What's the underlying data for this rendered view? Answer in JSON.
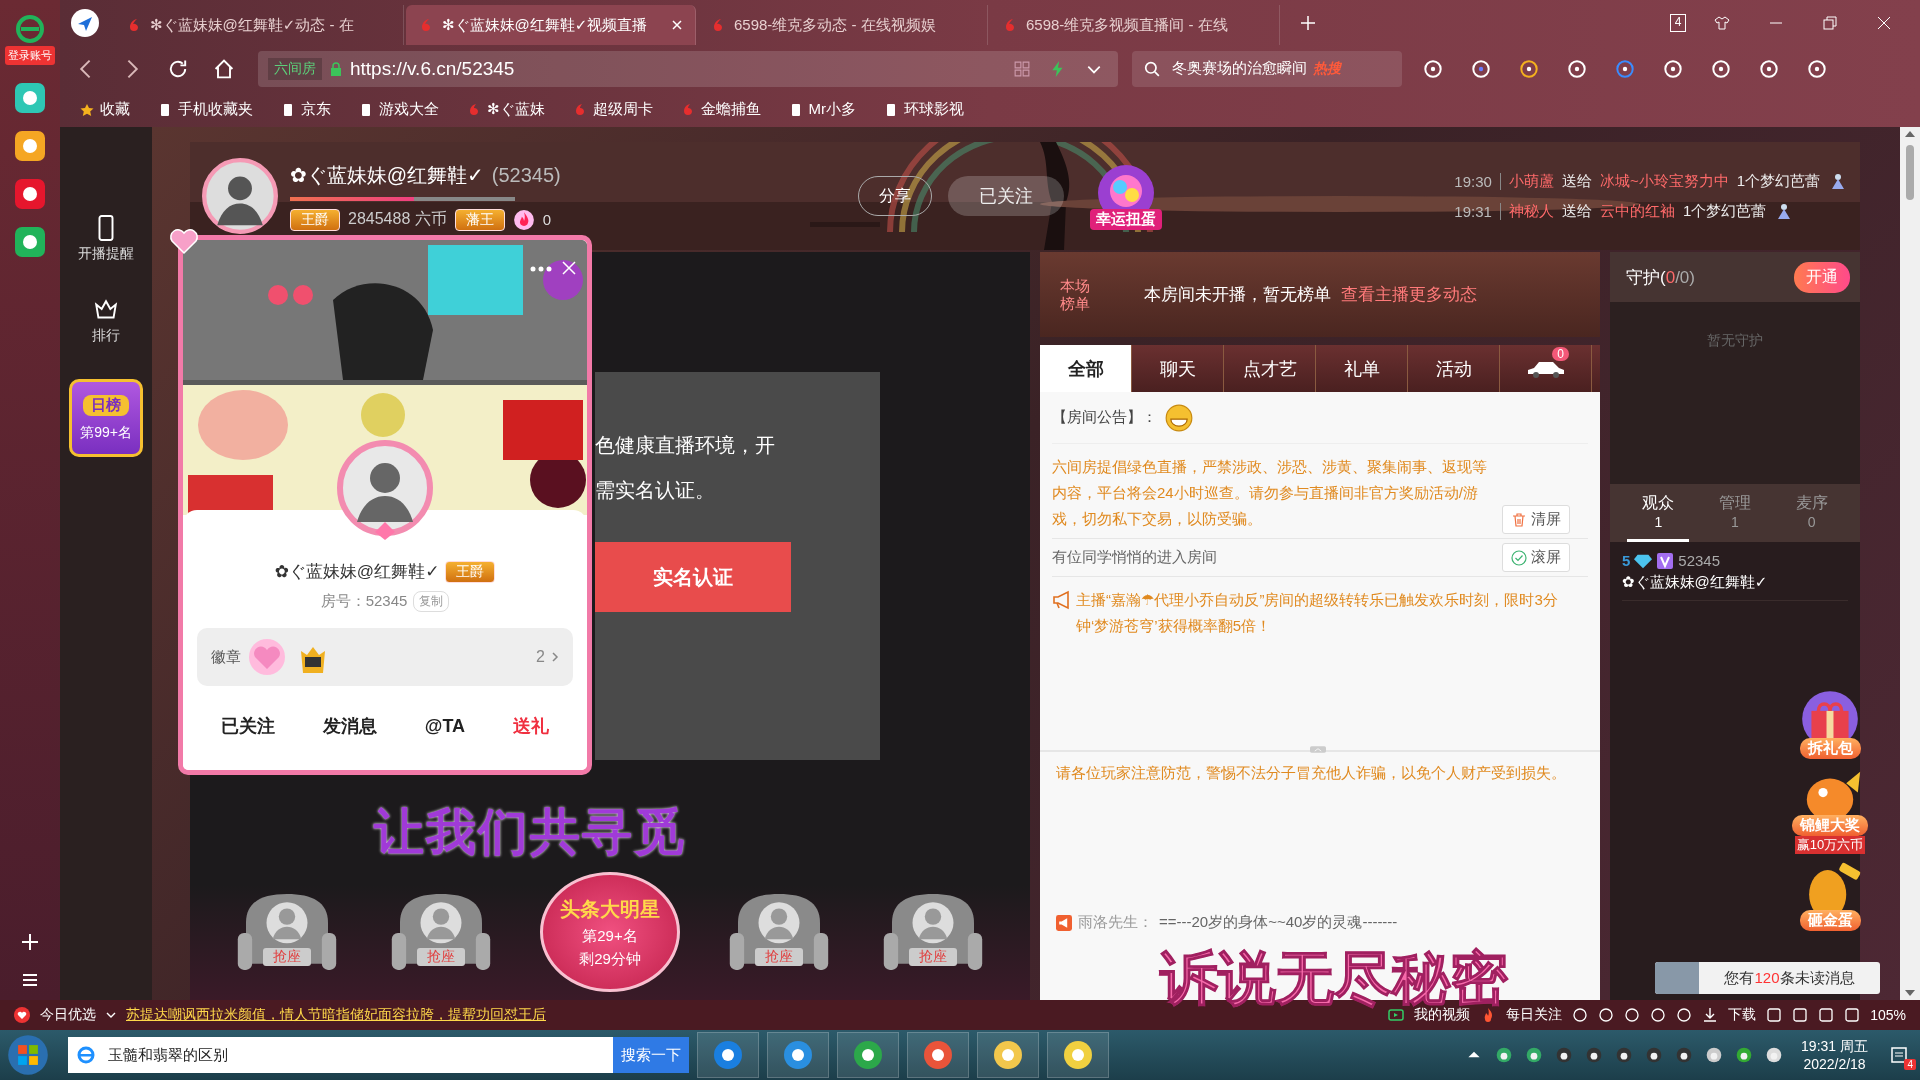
{
  "browser_sidebar": {
    "login": "登录账号"
  },
  "tabs": [
    {
      "title": "✻ぐ蓝妹妹@红舞鞋✓动态 - 在",
      "selected": false
    },
    {
      "title": "✻ぐ蓝妹妹@红舞鞋✓视频直播",
      "selected": true
    },
    {
      "title": "6598-维克多动态 - 在线视频娱",
      "selected": false
    },
    {
      "title": "6598-维克多视频直播间 - 在线",
      "selected": false
    }
  ],
  "tab_count": "4",
  "address_bar": {
    "site_label": "六间房",
    "url": "https://v.6.cn/52345"
  },
  "search": {
    "value": "冬奥赛场的治愈瞬间",
    "tag": "热搜"
  },
  "bookmarks": [
    "收藏",
    "手机收藏夹",
    "京东",
    "游戏大全",
    "✻ぐ蓝妹",
    "超级周卡",
    "金蟾捕鱼",
    "Mr小多",
    "环球影视"
  ],
  "site_sidebar": {
    "items": [
      "开播提醒",
      "排行"
    ],
    "daily_rank": {
      "title": "日榜",
      "rank": "第99+名"
    }
  },
  "anchor": {
    "name": "✿ぐ蓝妹妹@红舞鞋✓",
    "room_id": "(52345)",
    "level": 0.55,
    "title_badge": "王爵",
    "coins": "2845488 六币",
    "rank_badge": "藩王",
    "heat": "0",
    "share": "分享",
    "follow": "已关注",
    "lucky_egg": "幸运扭蛋"
  },
  "gift_feed": [
    {
      "time": "19:30",
      "sender": "小萌蘆",
      "verb": "送给",
      "receiver": "冰城~小玲宝努力中",
      "gift": "1个梦幻芭蕾"
    },
    {
      "time": "19:31",
      "sender": "神秘人",
      "verb": "送给",
      "receiver": "云中的红袖",
      "gift": "1个梦幻芭蕾"
    }
  ],
  "video": {
    "notice_lines": [
      "色健康直播环境，开",
      "需实名认证。"
    ],
    "verify_button": "实名认证",
    "banner_text": "让我们共寻觅",
    "overlay_text": "诉说无尽秘密",
    "seats": [
      {
        "kind": "seat",
        "label": "抢座"
      },
      {
        "kind": "seat",
        "label": "抢座"
      },
      {
        "kind": "star",
        "title": "头条大明星",
        "rank": "第29+名",
        "timer": "剩29分钟"
      },
      {
        "kind": "seat",
        "label": "抢座"
      },
      {
        "kind": "seat",
        "label": "抢座"
      }
    ]
  },
  "profile_card": {
    "name": "✿ぐ蓝妹妹@红舞鞋✓",
    "title_badge": "王爵",
    "room_label": "房号：52345",
    "copy": "复制",
    "badges_label": "徽章",
    "badge_count": "2",
    "actions": [
      {
        "label": "已关注",
        "highlight": false
      },
      {
        "label": "发消息",
        "highlight": false
      },
      {
        "label": "@TA",
        "highlight": false
      },
      {
        "label": "送礼",
        "highlight": true
      }
    ]
  },
  "chat": {
    "rank_label": [
      "本场",
      "榜单"
    ],
    "rank_empty": "本房间未开播，暂无榜单",
    "rank_link": "查看主播更多动态",
    "tabs": [
      {
        "kind": "text",
        "label": "全部",
        "selected": true
      },
      {
        "kind": "text",
        "label": "聊天",
        "selected": false
      },
      {
        "kind": "text",
        "label": "点才艺",
        "selected": false
      },
      {
        "kind": "text",
        "label": "礼单",
        "selected": false
      },
      {
        "kind": "text",
        "label": "活动",
        "selected": false
      },
      {
        "kind": "car",
        "badge": "0",
        "selected": false
      }
    ],
    "announcement_label": "【房间公告】：",
    "notice": "六间房提倡绿色直播，严禁涉政、涉恐、涉黄、聚集闹事、返现等内容，平台将会24小时巡查。请勿参与直播间非官方奖励活动/游戏，切勿私下交易，以防受骗。",
    "clear": "清屏",
    "scroll": "滚屏",
    "entry": "有位同学悄悄的进入房间",
    "broadcast": "主播“嘉瀚☂代理小乔自动反”房间的超级转转乐已触发欢乐时刻，限时3分钟‘梦游苍穹’获得概率翻5倍！",
    "warning": "请各位玩家注意防范，警惕不法分子冒充他人诈骗，以免个人财产受到损失。",
    "last_message": {
      "user": "雨洛先生：",
      "text": "==---20岁的身体~~40岁的灵魂-------"
    }
  },
  "guard": {
    "title": "守护(",
    "current": "0",
    "rest": "/0)",
    "open": "开通",
    "empty": "暂无守护"
  },
  "audience_tabs": [
    {
      "label": "观众",
      "count": "1",
      "selected": true
    },
    {
      "label": "管理",
      "count": "1",
      "selected": false
    },
    {
      "label": "麦序",
      "count": "0",
      "selected": false
    }
  ],
  "viewers": [
    {
      "level": "5",
      "id": "52345",
      "name": "✿ぐ蓝妹妹@红舞鞋✓"
    }
  ],
  "promos": [
    {
      "kind": "gift",
      "label": "拆礼包"
    },
    {
      "kind": "koi",
      "label": "锦鲤大奖",
      "sub": "赢10万六币"
    },
    {
      "kind": "egg",
      "label": "砸金蛋"
    }
  ],
  "unread": {
    "prefix": "您有",
    "count": "120",
    "suffix": "条未读消息"
  },
  "status_bar": {
    "today": "今日优选",
    "news": "苏提达嘲讽西拉米颜值，情人节暗指储妃面容拉胯，提帮功回怼王后",
    "my_video": "我的视频",
    "daily_follow": "每日关注",
    "download": "下载",
    "zoom": "105%"
  },
  "taskbar": {
    "search_value": "玉髓和翡翠的区别",
    "search_button": "搜索一下",
    "time": "19:31 周五",
    "date": "2022/2/18",
    "notification_count": "4"
  }
}
